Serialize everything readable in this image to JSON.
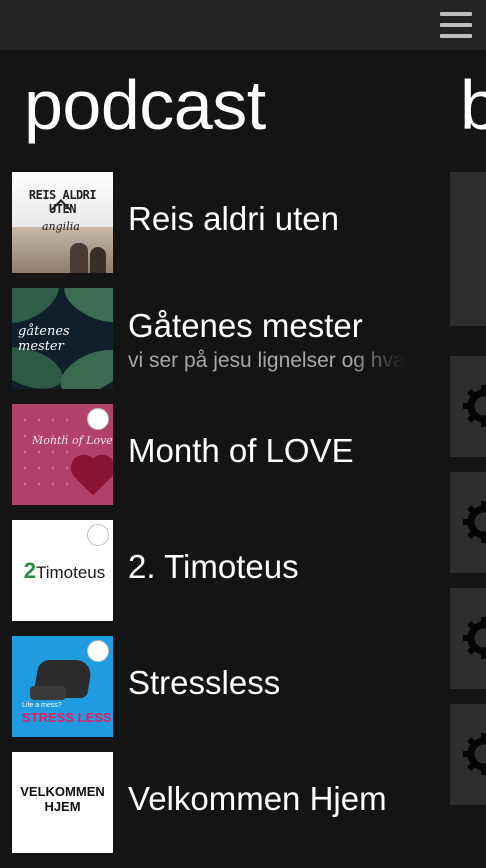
{
  "header": {
    "menu_icon": "hamburger-menu-icon"
  },
  "sections": {
    "current": "podcast",
    "next": "b"
  },
  "podcasts": [
    {
      "title": "Reis aldri uten",
      "subtitle": "",
      "thumb_text": "REIS ALDRI UTEN",
      "thumb_sign": "angilia"
    },
    {
      "title": "Gåtenes mester",
      "subtitle": "vi ser på jesu lignelser og hva",
      "thumb_text": "gåtenes mester"
    },
    {
      "title": "Month of LOVE",
      "subtitle": "",
      "thumb_text": "Month of Love"
    },
    {
      "title": "2. Timoteus",
      "subtitle": "",
      "thumb_text_a": "2",
      "thumb_text_b": "Timoteus"
    },
    {
      "title": "Stressless",
      "subtitle": "",
      "thumb_text": "STRESS LESS",
      "thumb_small": "Life a mess?"
    },
    {
      "title": "Velkommen Hjem",
      "subtitle": "",
      "thumb_text": "VELKOMMEN HJEM"
    }
  ],
  "right_column": {
    "icon": "gear-icon"
  },
  "colors": {
    "background": "#141414",
    "topbar": "#232323",
    "subtitle": "#a8a8a8"
  }
}
